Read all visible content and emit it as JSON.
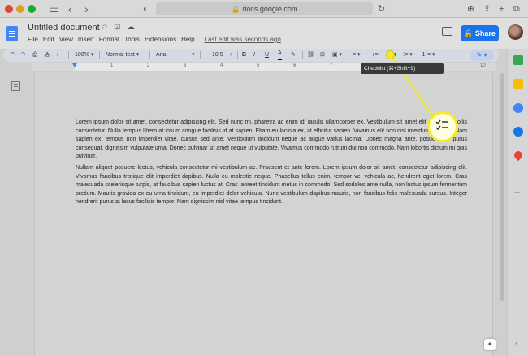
{
  "browser": {
    "url": "docs.google.com"
  },
  "doc": {
    "title": "Untitled document",
    "menu": [
      "File",
      "Edit",
      "View",
      "Insert",
      "Format",
      "Tools",
      "Extensions",
      "Help"
    ],
    "last_edit": "Last edit was seconds ago",
    "share_label": "Share"
  },
  "toolbar": {
    "zoom": "100%",
    "style": "Normal text",
    "font": "Arial",
    "font_size": "10.5",
    "bold": "B",
    "italic": "I",
    "underline": "U",
    "text_color": "A"
  },
  "tooltip": {
    "text": "Checklist (⌘+Shift+9)"
  },
  "ruler": {
    "labels": [
      "1",
      "2",
      "3",
      "4",
      "5",
      "6",
      "7",
      "8",
      "9",
      "10"
    ]
  },
  "body": {
    "paragraph1": "Lorem ipsum dolor sit amet, consectetur adipiscing elit. Sed nunc mi, pharetra ac enim id, iaculis ullamcorper ex. Vestibulum sit amet elit a magna mollis consectetur. Nulla tempus libero at ipsum congue facilisis id at sapien. Etiam eu lacinia ex, at efficitur sapien. Vivamus elit non nisl interdum rhoncus. Nam sapien ex, tempus non imperdiet vitae, cursus sed ante. Vestibulum tincidunt neque ac augue varius lacinia. Donec magna ante, posuere vel purus consequat, dignissim vulputate urna. Donec pulvinar sit amet neque ut vulputate. Vivamus commodo rutrum dui non commodo. Nam lobortis dictum mi quis pulvinar.",
    "paragraph2": "Nullam aliquet posuere lectus, vehicula consectetur mi vestibulum ac. Praesent et ante lorem. Lorem ipsum dolor sit amet, consectetur adipiscing elit. Vivamus faucibus tristique elit imperdiet dapibus. Nulla eu molestie neque. Phasellus tellus enim, tempor vel vehicula ac, hendrerit eget lorem. Cras malesuada scelerisque turpis, at faucibus sapien luctus at. Cras laoreet tincidunt metus in commodo. Sed sodales ante nulla, non luctus ipsum fermentum pretium. Mauris gravida ex eu urna tincidunt, eu imperdiet dolor vehicula. Nunc vestibulum dapibus mauris, non faucibus felis malesuada cursus. Integer hendrerit purus at lacus facilisis tempor. Nam dignissim nisl vitae tempus tincidunt."
  },
  "colors": {
    "share_blue": "#1a73e8",
    "highlight_yellow": "#f5ea29"
  }
}
